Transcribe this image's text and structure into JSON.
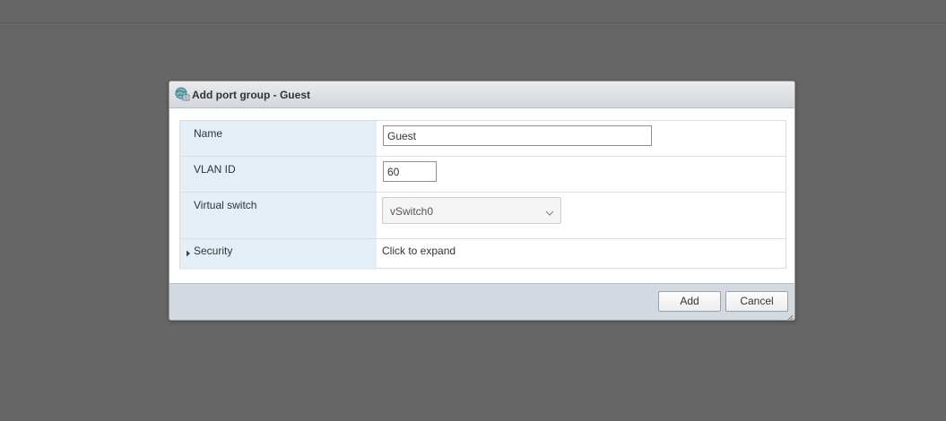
{
  "dialog": {
    "title": "Add port group - Guest",
    "title_icon": "network-portgroup-icon"
  },
  "form": {
    "name": {
      "label": "Name",
      "value": "Guest"
    },
    "vlan": {
      "label": "VLAN ID",
      "value": "60"
    },
    "vswitch": {
      "label": "Virtual switch",
      "selected": "vSwitch0"
    },
    "security": {
      "label": "Security",
      "value": "Click to expand",
      "icon": "expand-arrow-icon"
    }
  },
  "footer": {
    "add_label": "Add",
    "cancel_label": "Cancel"
  },
  "colors": {
    "overlay": "#666666",
    "label_column": "#e3eef6",
    "footer": "#d2d9e0"
  }
}
